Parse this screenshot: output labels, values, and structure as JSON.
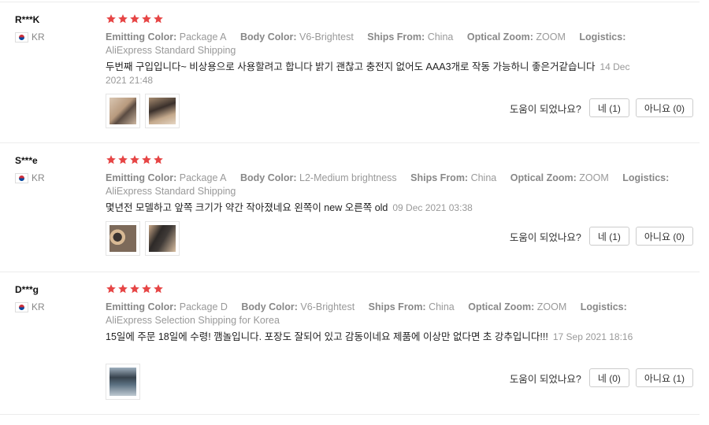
{
  "colors": {
    "star": "#e64545",
    "divider": "#ececec",
    "muted": "#999999"
  },
  "reviews": [
    {
      "name": "R***K",
      "country": "KR",
      "rating": 5,
      "attrs": [
        {
          "label": "Emitting Color:",
          "value": "Package A"
        },
        {
          "label": "Body Color:",
          "value": "V6-Brightest"
        },
        {
          "label": "Ships From:",
          "value": "China"
        },
        {
          "label": "Optical Zoom:",
          "value": "ZOOM"
        },
        {
          "label": "Logistics:",
          "value": "AliExpress Standard Shipping"
        }
      ],
      "text": "두번째 구입입니다~ 비상용으로 사용할려고 합니다 밝기 괜찮고 충전지 없어도 AAA3개로 작동 가능하니 좋은거같습니다",
      "date": "14 Dec 2021 21:48",
      "photos": [
        "flashlight-photo",
        "flashlight-photo"
      ],
      "helpful_q": "도움이 되었나요?",
      "yes": "네 (1)",
      "no": "아니요 (0)"
    },
    {
      "name": "S***e",
      "country": "KR",
      "rating": 5,
      "attrs": [
        {
          "label": "Emitting Color:",
          "value": "Package A"
        },
        {
          "label": "Body Color:",
          "value": "L2-Medium brightness"
        },
        {
          "label": "Ships From:",
          "value": "China"
        },
        {
          "label": "Optical Zoom:",
          "value": "ZOOM"
        },
        {
          "label": "Logistics:",
          "value": "AliExpress Standard Shipping"
        }
      ],
      "text": "몇년전 모델하고 앞쪽 크기가 약간 작아졌네요 왼쪽이 new 오른쪽 old",
      "date": "09 Dec 2021 03:38",
      "photos": [
        "flashlight-photo",
        "flashlight-photo"
      ],
      "helpful_q": "도움이 되었나요?",
      "yes": "네 (1)",
      "no": "아니요 (0)"
    },
    {
      "name": "D***g",
      "country": "KR",
      "rating": 5,
      "attrs": [
        {
          "label": "Emitting Color:",
          "value": "Package D"
        },
        {
          "label": "Body Color:",
          "value": "V6-Brightest"
        },
        {
          "label": "Ships From:",
          "value": "China"
        },
        {
          "label": "Optical Zoom:",
          "value": "ZOOM"
        },
        {
          "label": "Logistics:",
          "value": "AliExpress Selection Shipping for Korea"
        }
      ],
      "text": "15일에 주문 18일에 수령! 깸놀입니다. 포장도 잘되어 있고 감동이네요 제품에 이상만 없다면 초 강추입니다!!!",
      "date": "17 Sep 2021 18:16",
      "photos": [
        "flashlight-photo"
      ],
      "helpful_q": "도움이 되었나요?",
      "yes": "네 (0)",
      "no": "아니요 (1)"
    }
  ]
}
